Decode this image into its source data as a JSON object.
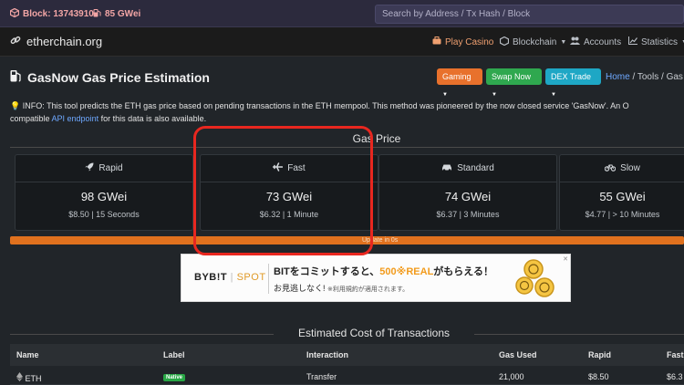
{
  "topbar": {
    "block": "Block: 13743910",
    "gas": "85 GWei",
    "search_placeholder": "Search by Address / Tx Hash / Block"
  },
  "navbar": {
    "brand": "etherchain.org",
    "casino": "Play Casino",
    "blockchain": "Blockchain",
    "accounts": "Accounts",
    "statistics": "Statistics"
  },
  "page": {
    "title": "GasNow Gas Price Estimation",
    "buttons": {
      "gaming": "Gaming",
      "swap": "Swap Now",
      "dex": "DEX Trade"
    },
    "breadcrumb": {
      "home": "Home",
      "tools": "Tools",
      "current": "Gas"
    }
  },
  "info": {
    "line1": "INFO: This tool predicts the ETH gas price based on pending transactions in the ETH mempool. This method was pioneered by the now closed service 'GasNow'. An O",
    "line2_prefix": "compatible ",
    "line2_link": "API endpoint",
    "line2_suffix": " for this data is also available."
  },
  "gas_price": {
    "heading": "Gas Price",
    "cards": [
      {
        "label": "Rapid",
        "icon": "rocket-icon",
        "price": "98 GWei",
        "usd": "$8.50",
        "time": "15 Seconds"
      },
      {
        "label": "Fast",
        "icon": "plane-icon",
        "price": "73 GWei",
        "usd": "$6.32",
        "time": "1 Minute"
      },
      {
        "label": "Standard",
        "icon": "car-icon",
        "price": "74 GWei",
        "usd": "$6.37",
        "time": "3 Minutes"
      },
      {
        "label": "Slow",
        "icon": "bicycle-icon",
        "price": "55 GWei",
        "usd": "$4.77",
        "time": "> 10 Minutes"
      }
    ],
    "update_label": "Update in 0s",
    "update_progress": 1.0
  },
  "ad": {
    "brand": "BYB!T",
    "brand_suffix": "SPOT",
    "line1_a": "BITをコミットすると、",
    "line1_highlight": "500",
    "line1_b": "REAL",
    "line1_c": "がもらえる！",
    "line2": "お見逃しなく! ",
    "line2_note": "※利用規約が適用されます。"
  },
  "costs": {
    "heading": "Estimated Cost of Transactions",
    "columns": [
      "Name",
      "Label",
      "Interaction",
      "Gas Used",
      "Rapid",
      "Fast"
    ],
    "rows": [
      {
        "name": "ETH",
        "label": "Native",
        "interaction": "Transfer",
        "gas_used": "21,000",
        "rapid": "$8.50",
        "fast": "$6.3"
      }
    ]
  },
  "colors": {
    "accent_orange": "#e0711e",
    "annotation_red": "#e8271f",
    "link_blue": "#6ea8fe",
    "badge_green": "#28a745"
  }
}
